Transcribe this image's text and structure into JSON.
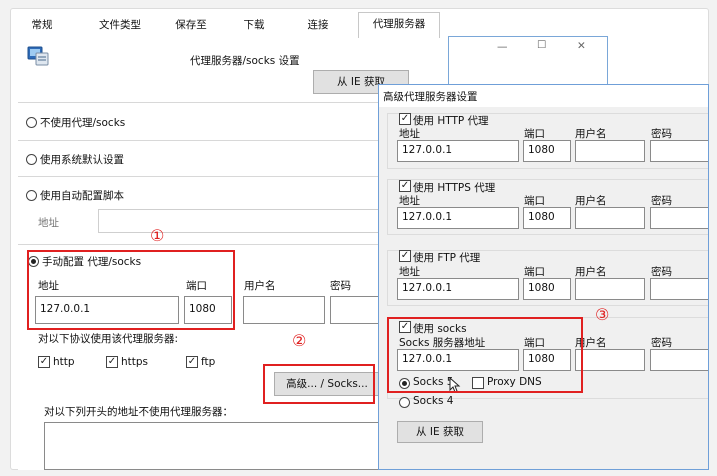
{
  "tabs": [
    "常规",
    "文件类型",
    "保存至",
    "下载",
    "连接",
    "代理服务器"
  ],
  "proxy_panel": {
    "heading": "代理服务器/socks 设置",
    "from_ie_button": "从 IE 获取",
    "options": [
      "不使用代理/socks",
      "使用系统默认设置",
      "使用自动配置脚本",
      "手动配置 代理/socks"
    ],
    "address_label": "地址",
    "manual": {
      "address_label": "地址",
      "port_label": "端口",
      "username_label": "用户名",
      "password_label": "密码",
      "address_value": "127.0.0.1",
      "port_value": "1080"
    },
    "protocols_label": "对以下协议使用该代理服务器:",
    "protocols": [
      "http",
      "https",
      "ftp"
    ],
    "advanced_button": "高级... / Socks...",
    "bypass_label": "对以下列开头的地址不使用代理服务器："
  },
  "annotations": [
    "①",
    "②",
    "③"
  ],
  "background_window": {
    "minimize": "—",
    "maximize": "☐",
    "close": "✕"
  },
  "advanced_dialog": {
    "title": "高级代理服务器设置",
    "sections": [
      {
        "check_label": "使用 HTTP 代理",
        "address_label": "地址",
        "port_label": "端口",
        "user_label": "用户名",
        "pass_label": "密码",
        "address": "127.0.0.1",
        "port": "1080"
      },
      {
        "check_label": "使用 HTTPS 代理",
        "address_label": "地址",
        "port_label": "端口",
        "user_label": "用户名",
        "pass_label": "密码",
        "address": "127.0.0.1",
        "port": "1080"
      },
      {
        "check_label": "使用 FTP 代理",
        "address_label": "地址",
        "port_label": "端口",
        "user_label": "用户名",
        "pass_label": "密码",
        "address": "127.0.0.1",
        "port": "1080"
      },
      {
        "check_label": "使用 socks",
        "address_label": "Socks 服务器地址",
        "port_label": "端口",
        "user_label": "用户名",
        "pass_label": "密码",
        "address": "127.0.0.1",
        "port": "1080"
      }
    ],
    "socks5_label": "Socks 5",
    "proxy_dns_label": "Proxy DNS",
    "socks4_label": "Socks 4",
    "from_ie_button": "从 IE 获取"
  },
  "colors": {
    "annotation": "#e02020",
    "dialog_border": "#6f9fd8"
  }
}
